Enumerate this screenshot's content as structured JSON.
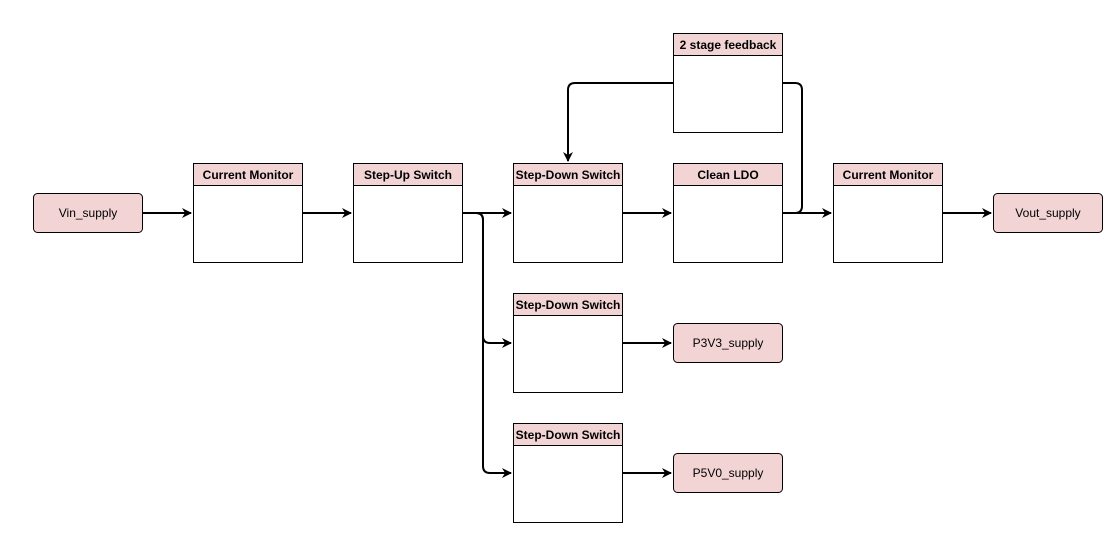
{
  "colors": {
    "header_fill": "#f2d4d4",
    "line": "#000000"
  },
  "supplies": {
    "vin": "Vin_supply",
    "vout": "Vout_supply",
    "p3v3": "P3V3_supply",
    "p5v0": "P5V0_supply"
  },
  "blocks": {
    "current_monitor_in": "Current Monitor",
    "step_up": "Step-Up Switch",
    "step_down_main": "Step-Down Switch",
    "clean_ldo": "Clean LDO",
    "current_monitor_out": "Current Monitor",
    "feedback": "2 stage feedback",
    "step_down_3v3": "Step-Down Switch",
    "step_down_5v0": "Step-Down Switch"
  }
}
